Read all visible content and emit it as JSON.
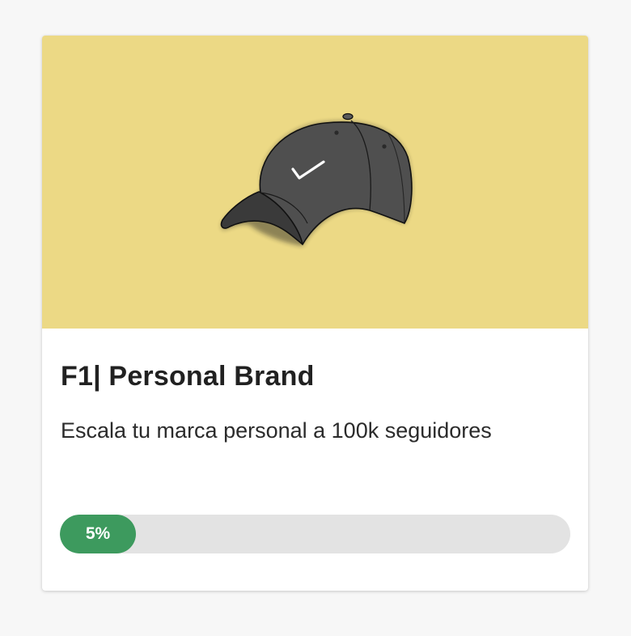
{
  "course": {
    "title": "F1| Personal Brand",
    "description": "Escala tu marca personal a 100k seguidores",
    "image_icon": "baseball-cap-icon",
    "hero_color": "#ecd985",
    "progress": {
      "percent": 5,
      "label": "5%",
      "fill_color": "#3d9a5e",
      "track_color": "#e3e3e3"
    }
  }
}
